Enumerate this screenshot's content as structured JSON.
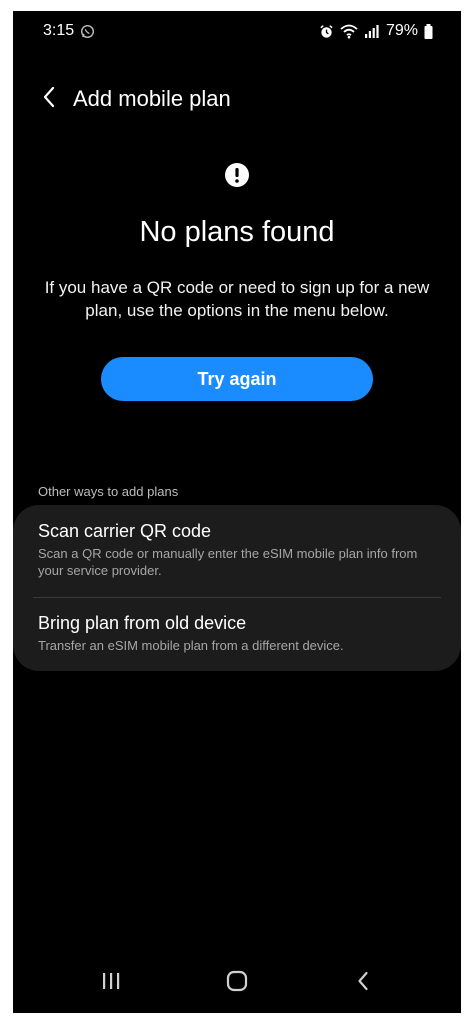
{
  "status_bar": {
    "time": "3:15",
    "battery": "79%",
    "icons": [
      "whatsapp-icon",
      "alarm-icon",
      "wifi-icon",
      "signal-icon",
      "battery-icon"
    ]
  },
  "header": {
    "title": "Add mobile plan",
    "back_icon": "chevron-left-icon"
  },
  "main": {
    "alert_icon": "alert-circle-icon",
    "heading": "No plans found",
    "description": "If you have a QR code or need to sign up for a new plan, use the options in the menu below.",
    "try_again_label": "Try again",
    "try_again_color": "#1a8cff"
  },
  "other_ways": {
    "label": "Other ways to add plans",
    "items": [
      {
        "title": "Scan carrier QR code",
        "description": "Scan a QR code or manually enter the eSIM mobile plan info from your service provider."
      },
      {
        "title": "Bring plan from old device",
        "description": "Transfer an eSIM mobile plan from a different device."
      }
    ]
  },
  "nav_bar": {
    "icons": [
      "recent-apps-icon",
      "home-icon",
      "back-icon"
    ]
  }
}
